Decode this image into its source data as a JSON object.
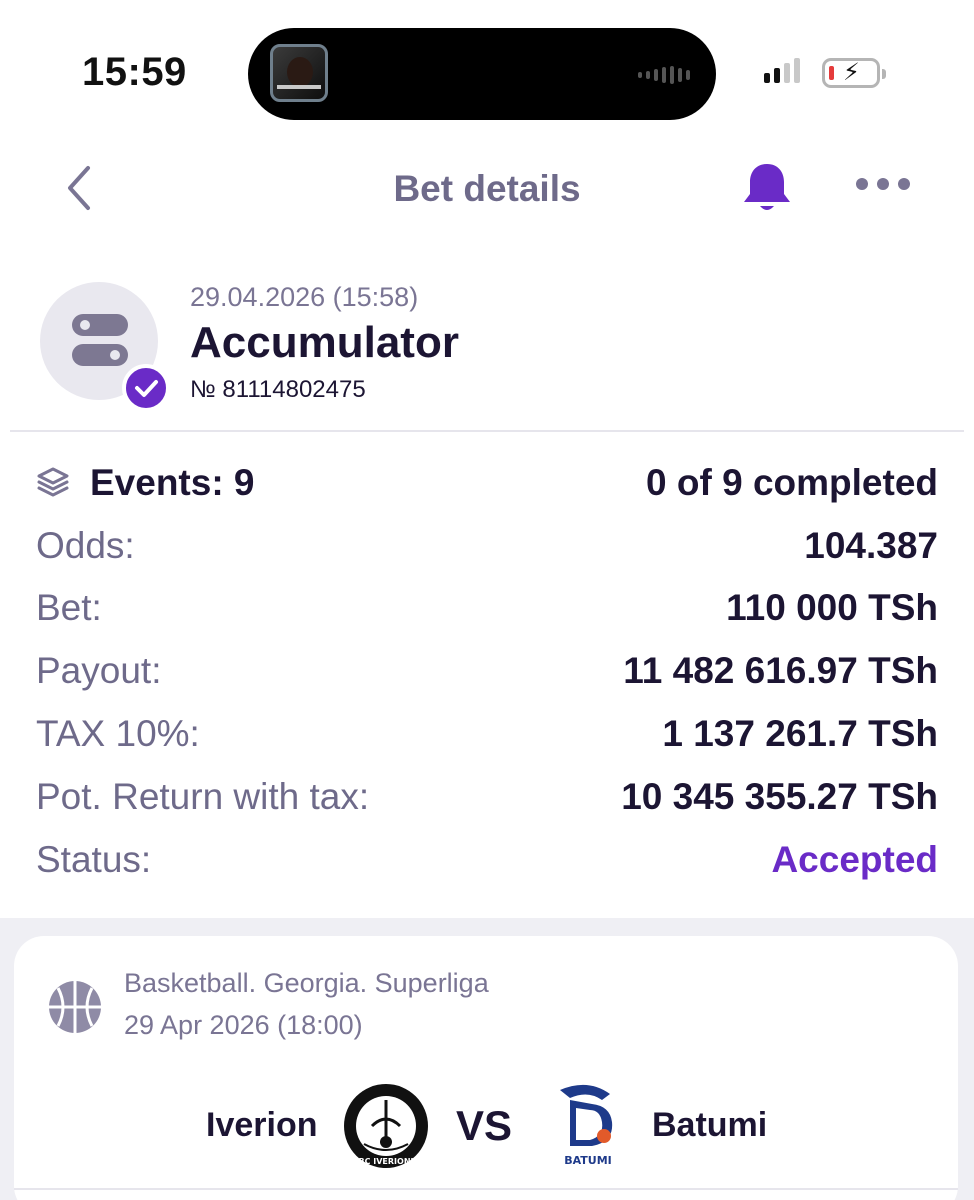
{
  "status_bar": {
    "time": "15:59"
  },
  "header": {
    "title": "Bet details"
  },
  "bet": {
    "date": "29.04.2026 (15:58)",
    "type": "Accumulator",
    "number": "№ 81114802475"
  },
  "details": {
    "events_label": "Events: 9",
    "events_value": "0 of 9 completed",
    "rows": [
      {
        "label": "Odds:",
        "value": "104.387"
      },
      {
        "label": "Bet:",
        "value": "110 000 TSh"
      },
      {
        "label": "Payout:",
        "value": "11 482 616.97 TSh"
      },
      {
        "label": "TAX 10%:",
        "value": "1 137 261.7 TSh"
      },
      {
        "label": "Pot. Return with tax:",
        "value": "10 345 355.27 TSh"
      },
      {
        "label": "Status:",
        "value": "Accepted"
      }
    ]
  },
  "event": {
    "league": "Basketball. Georgia. Superliga",
    "date": "29 Apr 2026 (18:00)",
    "home_team": "Iverion",
    "vs": "VS",
    "away_team": "Batumi",
    "home_logo_text": "BC IVERIONI",
    "away_logo_text": "BATUMI"
  },
  "colors": {
    "accent": "#6a2bc7",
    "text_primary": "#1c1533",
    "text_secondary": "#6e6a8a"
  },
  "icons": [
    "back-chevron-icon",
    "bell-icon",
    "more-icon",
    "accumulator-icon",
    "check-icon",
    "layers-icon",
    "basketball-icon"
  ]
}
